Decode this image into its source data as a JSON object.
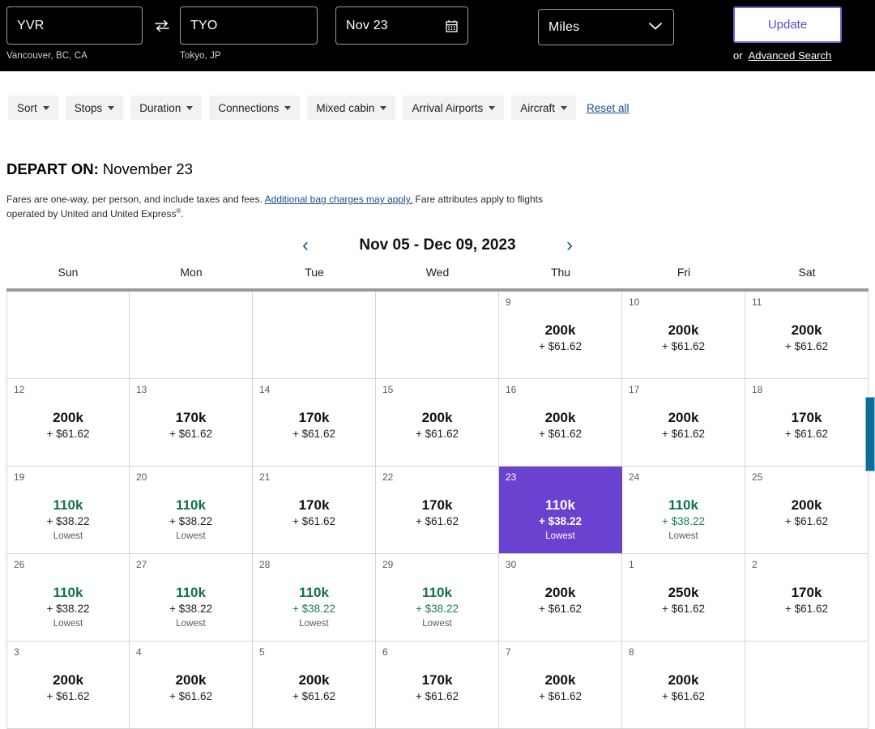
{
  "search": {
    "origin": {
      "code": "YVR",
      "city": "Vancouver, BC, CA"
    },
    "destination": {
      "code": "TYO",
      "city": "Tokyo, JP"
    },
    "date": "Nov 23",
    "currency": "Miles",
    "update_label": "Update",
    "or_label": "or",
    "advanced_search_label": "Advanced Search",
    "swap_glyph": "⇄",
    "calendar_glyph": "▦"
  },
  "filters": {
    "chips": [
      "Sort",
      "Stops",
      "Duration",
      "Connections",
      "Mixed cabin",
      "Arrival Airports",
      "Aircraft"
    ],
    "reset_label": "Reset all"
  },
  "depart": {
    "label": "DEPART ON:",
    "date": "November 23",
    "disclaimer_a": "Fares are one-way, per person, and include taxes and fees. ",
    "disclaimer_link": "Additional bag charges may apply.",
    "disclaimer_b": " Fare attributes apply to flights operated by United and United Express",
    "disclaimer_sup": "®",
    "disclaimer_c": "."
  },
  "calendar": {
    "range_title": "Nov 05 - Dec 09, 2023",
    "prev_glyph": "‹",
    "next_glyph": "›",
    "dow": [
      "Sun",
      "Mon",
      "Tue",
      "Wed",
      "Thu",
      "Fri",
      "Sat"
    ],
    "lowest_label": "Lowest",
    "selected_day": 23,
    "colors": {
      "selected_bg": "#6b42cf",
      "lowest_green": "#11714a",
      "scrollbar": "#0e6e96",
      "accent_purple": "#5b4bd0"
    },
    "cells": [
      {
        "day": "",
        "miles": "",
        "cash": "",
        "empty": true
      },
      {
        "day": "",
        "miles": "",
        "cash": "",
        "empty": true
      },
      {
        "day": "",
        "miles": "",
        "cash": "",
        "empty": true
      },
      {
        "day": "",
        "miles": "",
        "cash": "",
        "empty": true
      },
      {
        "day": "9",
        "miles": "200k",
        "cash": "+ $61.62"
      },
      {
        "day": "10",
        "miles": "200k",
        "cash": "+ $61.62"
      },
      {
        "day": "11",
        "miles": "200k",
        "cash": "+ $61.62"
      },
      {
        "day": "12",
        "miles": "200k",
        "cash": "+ $61.62"
      },
      {
        "day": "13",
        "miles": "170k",
        "cash": "+ $61.62"
      },
      {
        "day": "14",
        "miles": "170k",
        "cash": "+ $61.62"
      },
      {
        "day": "15",
        "miles": "200k",
        "cash": "+ $61.62"
      },
      {
        "day": "16",
        "miles": "200k",
        "cash": "+ $61.62"
      },
      {
        "day": "17",
        "miles": "200k",
        "cash": "+ $61.62"
      },
      {
        "day": "18",
        "miles": "170k",
        "cash": "+ $61.62"
      },
      {
        "day": "19",
        "miles": "110k",
        "cash": "+ $38.22",
        "lowest": true
      },
      {
        "day": "20",
        "miles": "110k",
        "cash": "+ $38.22",
        "lowest": true
      },
      {
        "day": "21",
        "miles": "170k",
        "cash": "+ $61.62"
      },
      {
        "day": "22",
        "miles": "170k",
        "cash": "+ $61.62"
      },
      {
        "day": "23",
        "miles": "110k",
        "cash": "+ $38.22",
        "lowest": true,
        "selected": true
      },
      {
        "day": "24",
        "miles": "110k",
        "cash": "+ $38.22",
        "lowest": true,
        "lowest2": true
      },
      {
        "day": "25",
        "miles": "200k",
        "cash": "+ $61.62"
      },
      {
        "day": "26",
        "miles": "110k",
        "cash": "+ $38.22",
        "lowest": true
      },
      {
        "day": "27",
        "miles": "110k",
        "cash": "+ $38.22",
        "lowest": true
      },
      {
        "day": "28",
        "miles": "110k",
        "cash": "+ $38.22",
        "lowest": true,
        "lowest2": true
      },
      {
        "day": "29",
        "miles": "110k",
        "cash": "+ $38.22",
        "lowest": true,
        "lowest2": true
      },
      {
        "day": "30",
        "miles": "200k",
        "cash": "+ $61.62"
      },
      {
        "day": "1",
        "miles": "250k",
        "cash": "+ $61.62"
      },
      {
        "day": "2",
        "miles": "170k",
        "cash": "+ $61.62"
      },
      {
        "day": "3",
        "miles": "200k",
        "cash": "+ $61.62"
      },
      {
        "day": "4",
        "miles": "200k",
        "cash": "+ $61.62"
      },
      {
        "day": "5",
        "miles": "200k",
        "cash": "+ $61.62"
      },
      {
        "day": "6",
        "miles": "170k",
        "cash": "+ $61.62"
      },
      {
        "day": "7",
        "miles": "200k",
        "cash": "+ $61.62"
      },
      {
        "day": "8",
        "miles": "200k",
        "cash": "+ $61.62"
      },
      {
        "day": "",
        "miles": "",
        "cash": "",
        "empty": true
      }
    ]
  }
}
